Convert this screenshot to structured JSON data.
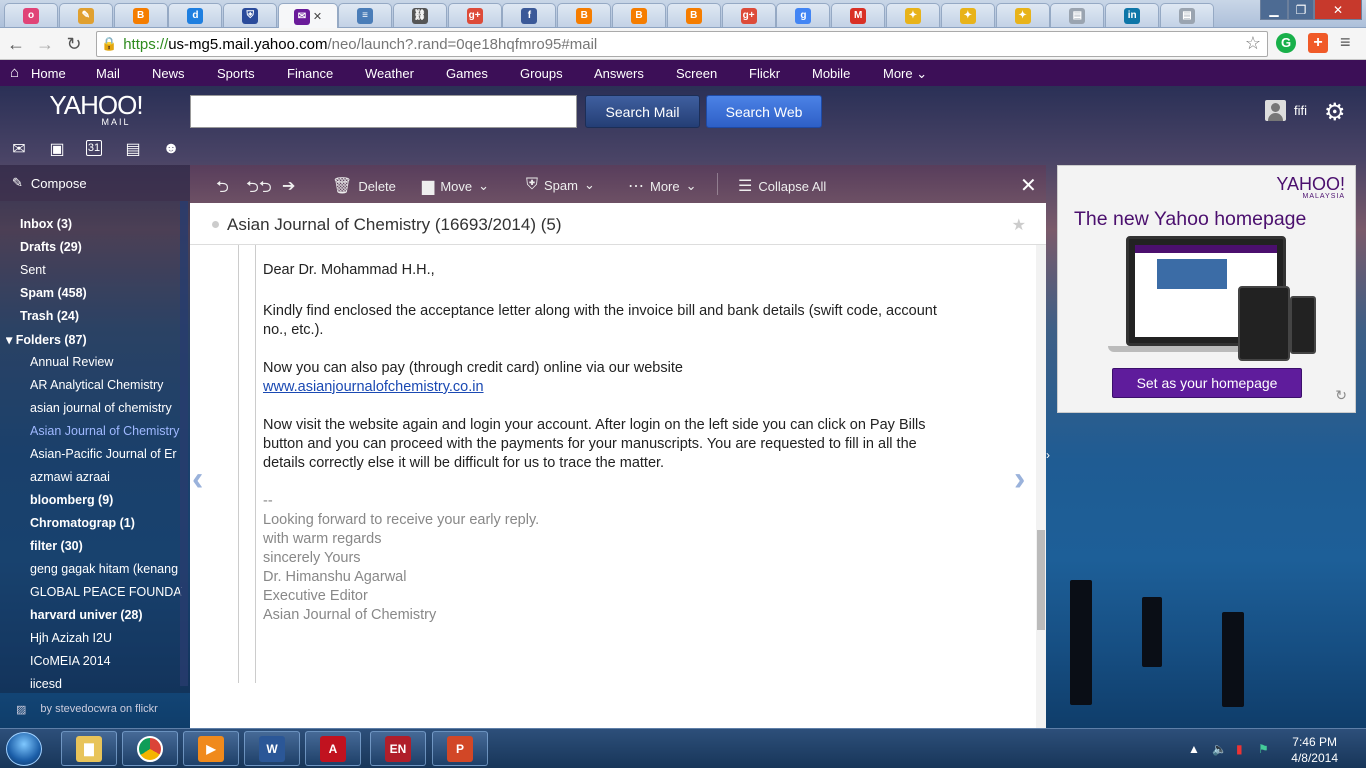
{
  "browser": {
    "tabs": [
      {
        "icon": "opera-icon",
        "color": "#e04377"
      },
      {
        "icon": "notes-icon",
        "color": "#e0a030"
      },
      {
        "icon": "blogger-icon",
        "color": "#f57d00"
      },
      {
        "icon": "d-icon",
        "color": "#1e7fe0"
      },
      {
        "icon": "shield-icon",
        "color": "#2a4b9b"
      },
      {
        "icon": "mail-icon",
        "color": "#6a1b9a",
        "active": true
      },
      {
        "icon": "scribd-icon",
        "color": "#4a7db8"
      },
      {
        "icon": "chain-icon",
        "color": "#555555"
      },
      {
        "icon": "google-plus-icon",
        "color": "#dd4b39"
      },
      {
        "icon": "facebook-icon",
        "color": "#3b5998"
      },
      {
        "icon": "blogger-icon",
        "color": "#f57d00"
      },
      {
        "icon": "blogger-icon",
        "color": "#f57d00"
      },
      {
        "icon": "blogger-icon",
        "color": "#f57d00"
      },
      {
        "icon": "google-plus-icon",
        "color": "#dd4b39"
      },
      {
        "icon": "google-icon",
        "color": "#4285f4"
      },
      {
        "icon": "gmail-icon",
        "color": "#d93025"
      },
      {
        "icon": "puzzle-icon",
        "color": "#e8b31a"
      },
      {
        "icon": "puzzle-icon",
        "color": "#e8b31a"
      },
      {
        "icon": "puzzle-icon",
        "color": "#e8b31a"
      },
      {
        "icon": "page-icon",
        "color": "#9aa4b0"
      },
      {
        "icon": "linkedin-icon",
        "color": "#0e76a8"
      },
      {
        "icon": "page-icon",
        "color": "#9aa4b0"
      }
    ],
    "favicon_letters": [
      "o",
      "✎",
      "B",
      "d",
      "⛨",
      "✉",
      "≡",
      "⛓",
      "g+",
      "f",
      "B",
      "B",
      "B",
      "g+",
      "g",
      "M",
      "✦",
      "✦",
      "✦",
      "▤",
      "in",
      "▤"
    ],
    "url_scheme": "https://",
    "url_host": "us-mg5.mail.yahoo.com",
    "url_path": "/neo/launch?.rand=0qe18hqfmro95#mail"
  },
  "ynav": {
    "items": [
      "Home",
      "Mail",
      "News",
      "Sports",
      "Finance",
      "Weather",
      "Games",
      "Groups",
      "Answers",
      "Screen",
      "Flickr",
      "Mobile",
      "More"
    ]
  },
  "header": {
    "logo": "YAHOO!",
    "logo_sub": "MAIL",
    "search_mail": "Search Mail",
    "search_web": "Search Web",
    "search_placeholder": "",
    "username": "fifi"
  },
  "sidebar": {
    "compose": "Compose",
    "inbox": "Inbox (3)",
    "drafts": "Drafts (29)",
    "sent": "Sent",
    "spam": "Spam (458)",
    "trash": "Trash (24)",
    "folders": "Folders (87)",
    "folder_items": [
      "Annual Review",
      "AR Analytical Chemistry",
      "asian journal of chemistry",
      "Asian Journal of Chemistry",
      "Asian-Pacific Journal of Er",
      "azmawi azraai",
      "bloomberg  (9)",
      "Chromatograp  (1)",
      "filter  (30)",
      "geng gagak hitam (kenang",
      "GLOBAL PEACE FOUNDAT",
      "harvard univer  (28)",
      "Hjh Azizah I2U",
      "ICoMEIA 2014",
      "iicesd"
    ],
    "credit": "by stevedocwra on flickr"
  },
  "toolbar": {
    "delete": "Delete",
    "move": "Move",
    "spam": "Spam",
    "more": "More",
    "collapse": "Collapse All"
  },
  "message": {
    "subject": "Asian Journal of Chemistry (16693/2014) (5)",
    "greeting": "Dear Dr. Mohammad H.H.,",
    "p1a": "Kindly find enclosed the acceptance letter along with the invoice bill and bank details (swift code, account",
    "p1b": "no., etc.).",
    "p2a": "Now you can also pay (through credit card) online via our website",
    "link": "www.asianjournalofchemistry.co.in",
    "p3a": "Now visit the website again and login your account. After login on the left side you can click on Pay Bills",
    "p3b": "button and you can proceed with the payments for your manuscripts. You are requested to fill in all the",
    "p3c": "details correctly else it will be difficult for us to trace the matter.",
    "sig_sep": "--",
    "sig1": "Looking forward to receive your early reply.",
    "sig2": "with warm regards",
    "sig3": "sincerely Yours",
    "sig4": "Dr. Himanshu Agarwal",
    "sig5": "Executive Editor",
    "sig6": "Asian Journal of Chemistry"
  },
  "ad": {
    "brand": "YAHOO!",
    "brand_sub": "MALAYSIA",
    "headline": "The new Yahoo homepage",
    "cta": "Set as your homepage"
  },
  "taskbar": {
    "time": "7:46 PM",
    "date": "4/8/2014"
  }
}
